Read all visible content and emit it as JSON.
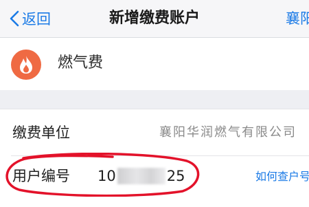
{
  "nav": {
    "back_label": "返回",
    "title": "新增缴费账户",
    "right_label": "襄阳"
  },
  "service": {
    "icon": "flame-icon",
    "name": "燃气费"
  },
  "form": {
    "company": {
      "label": "缴费单位",
      "value": "襄阳华润燃气有限公司"
    },
    "account": {
      "label": "用户编号",
      "value_prefix": "10",
      "value_suffix": "25",
      "help_link": "如何查户号"
    }
  },
  "colors": {
    "link_blue": "#1a7ae6",
    "flame_orange": "#ef6a43",
    "annotation_red": "#e3122a",
    "page_bg": "#eeeff3"
  }
}
